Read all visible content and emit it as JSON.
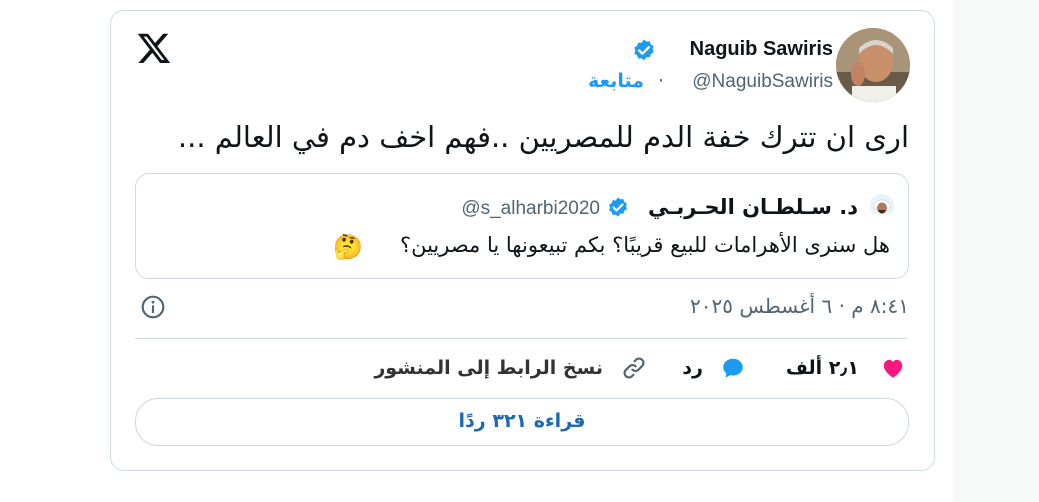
{
  "colors": {
    "accent": "#1d9bf0",
    "text": "#0f1419",
    "muted": "#536471",
    "border": "#cfd9de",
    "like": "#f91880"
  },
  "author": {
    "name": "Naguib Sawiris",
    "handle": "@NaguibSawiris",
    "follow_label": "متابعة",
    "separator": "·"
  },
  "tweet": {
    "text": "ارى ان تترك خفة الدم للمصريين ..فهم اخف دم في العالم ..."
  },
  "quote": {
    "name": "د. سـلطـان الحـربـي",
    "handle": "@s_alharbi2020",
    "text": "هل سنرى الأهرامات للبيع قريبًا؟ بكم تبيعونها يا مصريين؟",
    "emoji": "🤔"
  },
  "meta": {
    "timestamp": "٨:٤١ م · ٦ أغسطس ٢٠٢٥"
  },
  "actions": {
    "like_count": "٢٫١ ألف",
    "reply_label": "رد",
    "copy_link_label": "نسخ الرابط إلى المنشور"
  },
  "read_replies_label": "قراءة ٣٢١ ردًا",
  "icons": [
    "x-logo-icon",
    "verified-badge-icon",
    "info-icon",
    "heart-icon",
    "reply-bubble-icon",
    "link-icon"
  ]
}
